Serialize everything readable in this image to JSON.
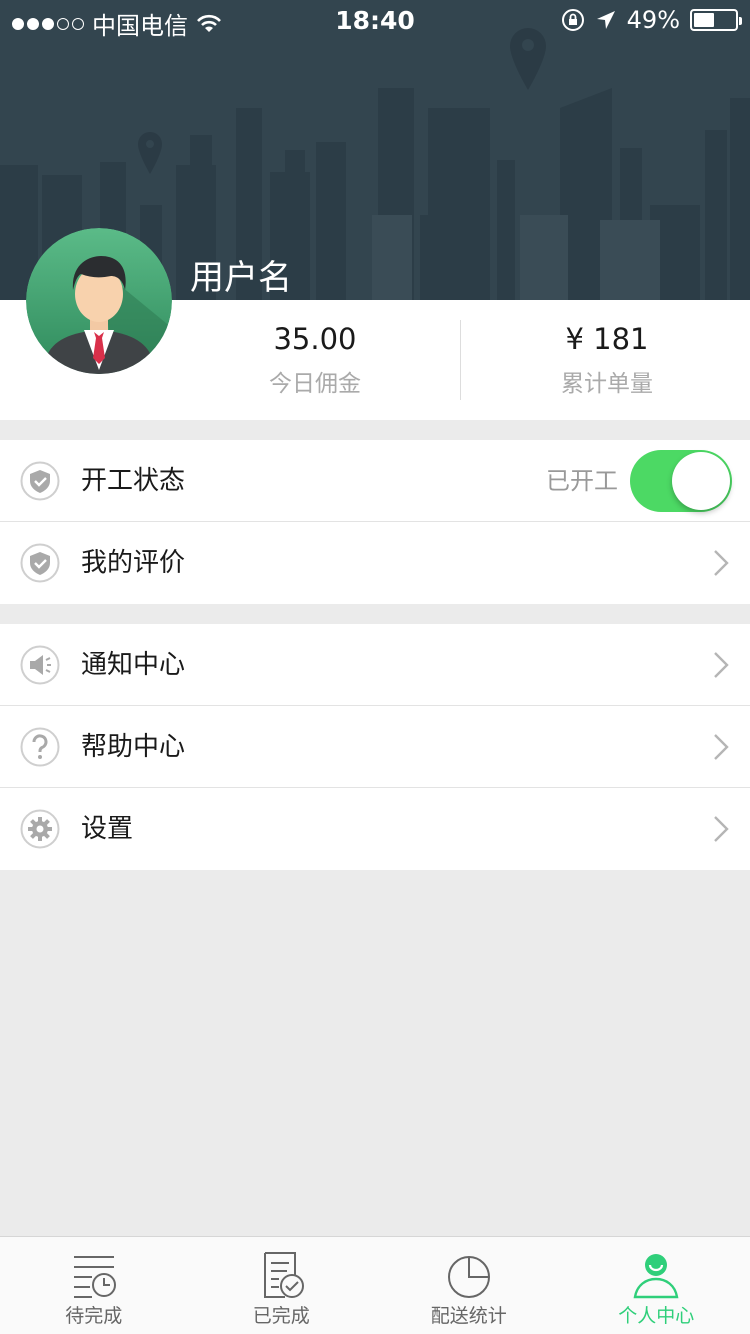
{
  "status_bar": {
    "carrier": "中国电信",
    "time": "18:40",
    "battery": "49%",
    "signal_bars": 3
  },
  "profile": {
    "username": "用户名",
    "commission_value": "35.00",
    "commission_label": "今日佣金",
    "orders_value": "¥ 181",
    "orders_label": "累计单量"
  },
  "menu": {
    "work_status": {
      "label": "开工状态",
      "state_text": "已开工",
      "enabled": true
    },
    "my_reviews": {
      "label": "我的评价"
    },
    "notifications": {
      "label": "通知中心"
    },
    "help": {
      "label": "帮助中心"
    },
    "settings": {
      "label": "设置"
    }
  },
  "tabs": [
    {
      "label": "待完成",
      "icon": "list-clock-icon",
      "active": false
    },
    {
      "label": "已完成",
      "icon": "doc-check-icon",
      "active": false
    },
    {
      "label": "配送统计",
      "icon": "pie-chart-icon",
      "active": false
    },
    {
      "label": "个人中心",
      "icon": "person-icon",
      "active": true
    }
  ],
  "colors": {
    "header_bg": "#33454f",
    "accent_green": "#2fcf7a",
    "toggle_on": "#4cd964"
  }
}
